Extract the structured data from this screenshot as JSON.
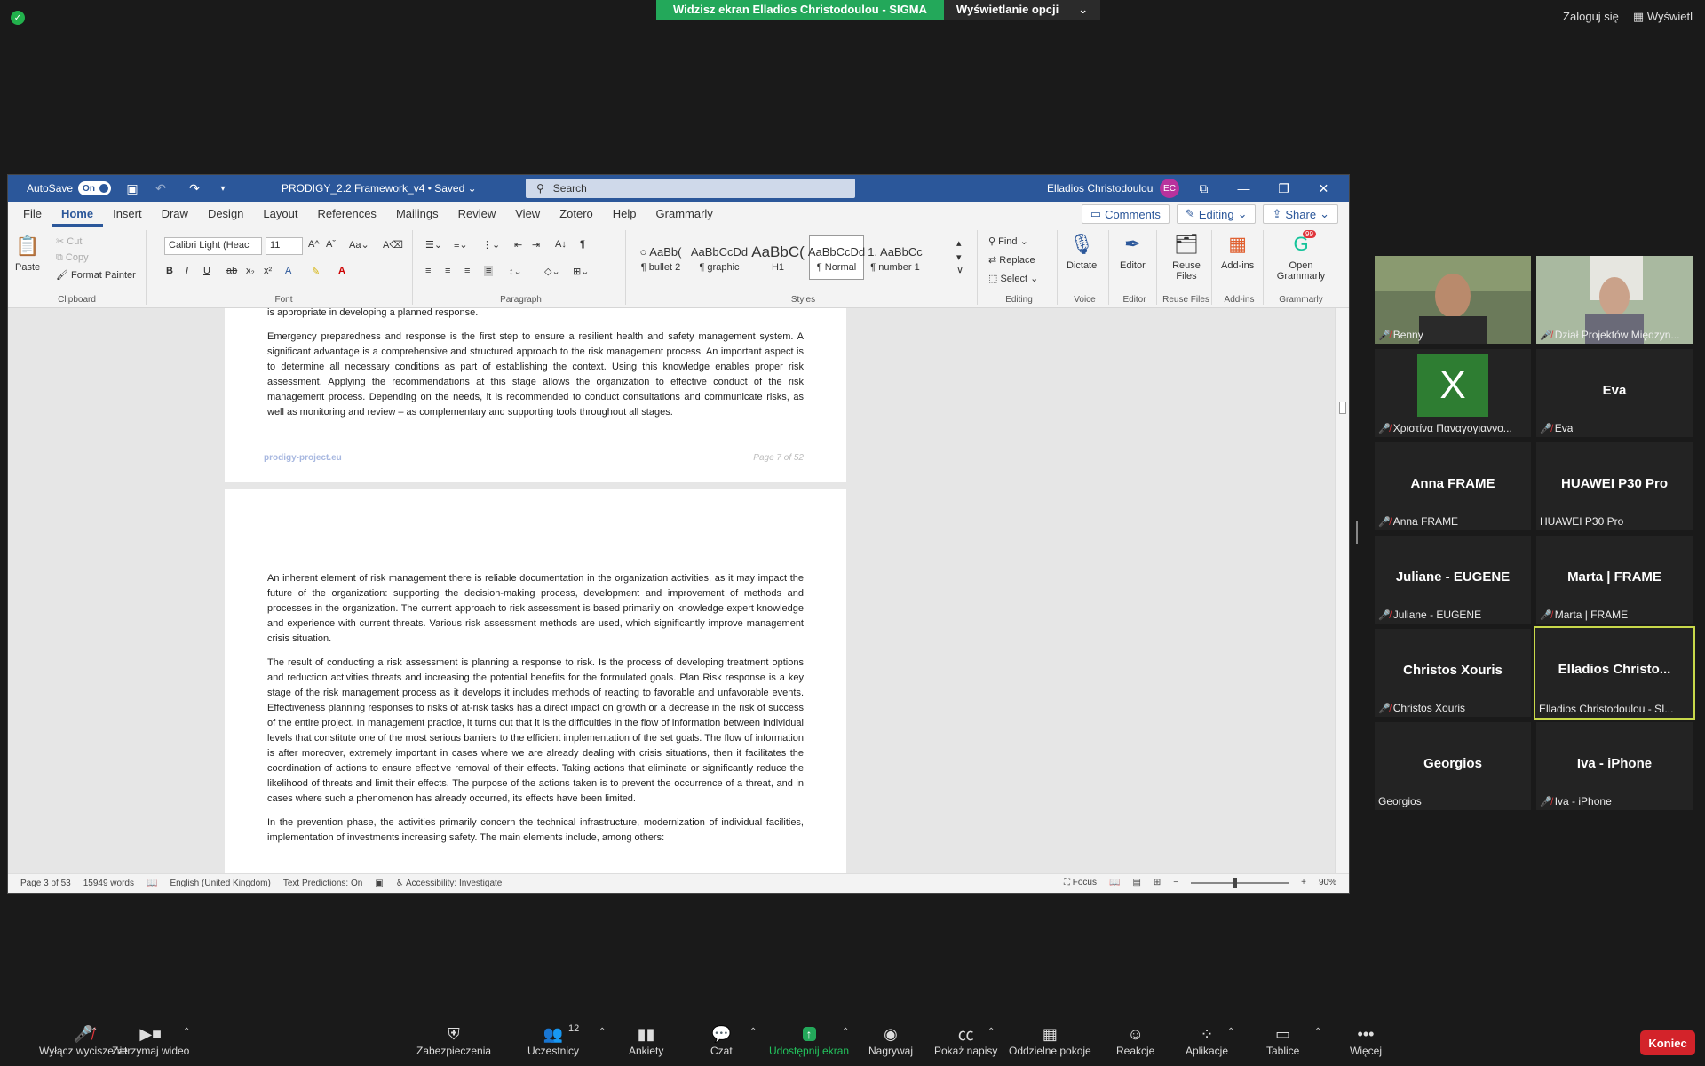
{
  "zoom_top": {
    "share_text": "Widzisz ekran Elladios Christodoulou - SIGMA",
    "view_options": "Wyświetlanie opcji",
    "login": "Zaloguj się",
    "view": "Wyświetl"
  },
  "word": {
    "autosave_label": "AutoSave",
    "autosave_state": "On",
    "doc_title": "PRODIGY_2.2 Framework_v4 • Saved",
    "search_placeholder": "Search",
    "user_name": "Elladios Christodoulou",
    "user_initials": "EC",
    "tabs": [
      "File",
      "Home",
      "Insert",
      "Draw",
      "Design",
      "Layout",
      "References",
      "Mailings",
      "Review",
      "View",
      "Zotero",
      "Help",
      "Grammarly"
    ],
    "comments_label": "Comments",
    "editing_label": "Editing",
    "share_label": "Share",
    "ribbon": {
      "paste": "Paste",
      "cut": "Cut",
      "copy": "Copy",
      "format_painter": "Format Painter",
      "clipboard": "Clipboard",
      "font_name": "Calibri Light (Heac",
      "font_size": "11",
      "font": "Font",
      "paragraph": "Paragraph",
      "styles_label": "Styles",
      "styles": [
        {
          "preview": "○ AaBb(",
          "name": "¶ bullet 2"
        },
        {
          "preview": "AaBbCcDd",
          "name": "¶ graphic"
        },
        {
          "preview": "AaBbC(",
          "name": "H1"
        },
        {
          "preview": "AaBbCcDd",
          "name": "¶ Normal"
        },
        {
          "preview": "1. AaBbCc",
          "name": "¶ number 1"
        }
      ],
      "find": "Find",
      "replace": "Replace",
      "select": "Select",
      "editing": "Editing",
      "dictate": "Dictate",
      "voice": "Voice",
      "editor": "Editor",
      "editor_group": "Editor",
      "reuse_files": "Reuse Files",
      "reuse_group": "Reuse Files",
      "addins": "Add-ins",
      "addins_group": "Add-ins",
      "open_grammarly": "Open Grammarly",
      "grammarly_group": "Grammarly",
      "grammarly_badge": "99"
    },
    "page1": {
      "bullet": "taking into account the needs and capabilities of all relevant people interested parties and ensuring their involvement if this is appropriate in developing a planned response.",
      "para": "Emergency preparedness and response is the first step to ensure a resilient health and safety management system. A significant advantage is a comprehensive and structured approach to the risk management process. An important aspect is to determine all necessary conditions as part of establishing the context. Using this knowledge enables proper risk assessment. Applying the recommendations at this stage allows the organization to effective conduct of the risk management process. Depending on the needs, it is recommended to conduct consultations and communicate risks, as well as monitoring and review – as complementary and supporting tools throughout all stages.",
      "footer_left": "prodigy-project.eu",
      "footer_right": "Page 7 of 52"
    },
    "page2": {
      "p1": "An inherent element of risk management there is reliable documentation in the organization activities, as it may impact the future of the organization: supporting the decision-making process, development and improvement of methods and processes in the organization. The current approach to risk assessment is based primarily on knowledge expert knowledge and experience with current threats. Various risk assessment methods are used, which significantly improve management crisis situation.",
      "p2": "The result of conducting a risk assessment is planning a response to risk. Is the process of developing treatment options and reduction activities threats and increasing the potential benefits for the formulated goals. Plan Risk response is a key stage of the risk management process as it develops it includes methods of reacting to favorable and unfavorable events. Effectiveness planning responses to risks of at-risk tasks has a direct impact on growth or a decrease in the risk of success of the entire project. In management practice, it turns out that it is the difficulties in the flow of information between individual levels that constitute one of the most serious barriers to the efficient implementation of the set goals. The flow of information is after moreover, extremely important in cases where we are already dealing with crisis situations, then it facilitates the coordination of actions to ensure effective removal of their effects. Taking actions that eliminate or significantly reduce the likelihood of threats and limit their effects. The purpose of the actions taken is to prevent the occurrence of a threat, and in cases where such a phenomenon has already occurred, its effects have been limited.",
      "p3": "In the prevention phase, the activities primarily concern the technical infrastructure, modernization of individual facilities, implementation of investments increasing safety. The main elements include, among others:"
    },
    "status": {
      "page": "Page 3 of 53",
      "words": "15949 words",
      "language": "English (United Kingdom)",
      "predictions": "Text Predictions: On",
      "accessibility": "Accessibility: Investigate",
      "focus": "Focus",
      "zoom": "90%"
    }
  },
  "participants": [
    {
      "name": "Benny",
      "muted": true,
      "display": ""
    },
    {
      "name": "Dział Projektów Międzyn...",
      "muted": true,
      "display": ""
    },
    {
      "name": "Χριστίνα Παναγογιαννο...",
      "muted": true,
      "display": "X"
    },
    {
      "name": "Eva",
      "muted": true,
      "display": "Eva"
    },
    {
      "name": "Anna FRAME",
      "muted": true,
      "display": "Anna FRAME"
    },
    {
      "name": "HUAWEI P30 Pro",
      "muted": false,
      "display": "HUAWEI P30 Pro"
    },
    {
      "name": "Juliane - EUGENE",
      "muted": true,
      "display": "Juliane - EUGENE"
    },
    {
      "name": "Marta | FRAME",
      "muted": true,
      "display": "Marta | FRAME"
    },
    {
      "name": "Christos Xouris",
      "muted": true,
      "display": "Christos Xouris"
    },
    {
      "name": "Elladios Christodoulou - SI...",
      "muted": false,
      "display": "Elladios  Christo..."
    },
    {
      "name": "Georgios",
      "muted": false,
      "display": "Georgios"
    },
    {
      "name": "Iva - iPhone",
      "muted": true,
      "display": "Iva - iPhone"
    }
  ],
  "toolbar": {
    "unmute": "Wyłącz wyciszenie",
    "stop_video": "Zatrzymaj wideo",
    "security": "Zabezpieczenia",
    "participants": "Uczestnicy",
    "participants_count": "12",
    "polls": "Ankiety",
    "chat": "Czat",
    "share": "Udostępnij ekran",
    "record": "Nagrywaj",
    "captions": "Pokaż napisy",
    "breakout": "Oddzielne pokoje",
    "reactions": "Reakcje",
    "apps": "Aplikacje",
    "whiteboards": "Tablice",
    "more": "Więcej",
    "end": "Koniec"
  }
}
